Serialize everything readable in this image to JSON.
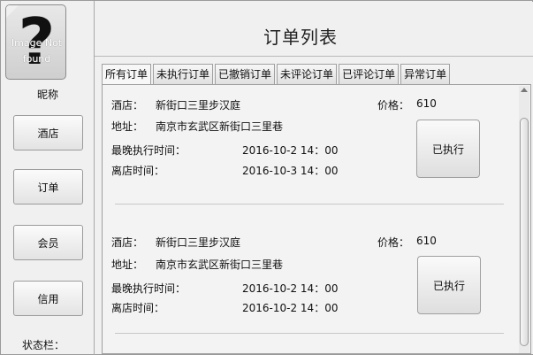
{
  "sidebar": {
    "avatar_text": "Image Not found",
    "nickname": "昵称",
    "buttons": [
      "酒店",
      "订单",
      "会员",
      "信用"
    ],
    "status_label": "状态栏："
  },
  "main": {
    "title": "订单列表",
    "tabs": [
      "所有订单",
      "未执行订单",
      "已撤销订单",
      "未评论订单",
      "已评论订单",
      "异常订单"
    ],
    "active_tab": "所有订单"
  },
  "labels": {
    "hotel": "酒店：",
    "address": "地址：",
    "price": "价格：",
    "latest_exec": "最晚执行时间：",
    "leave": "离店时间："
  },
  "orders": [
    {
      "hotel": "新街口三里步汉庭",
      "address": "南京市玄武区新街口三里巷",
      "price": "610",
      "latest_exec": "2016-10-2 14：00",
      "leave": "2016-10-3 14：00",
      "status_button": "已执行"
    },
    {
      "hotel": "新街口三里步汉庭",
      "address": "南京市玄武区新街口三里巷",
      "price": "610",
      "latest_exec": "2016-10-2 14：00",
      "leave": "2016-10-2 14：00",
      "status_button": "已执行"
    }
  ]
}
